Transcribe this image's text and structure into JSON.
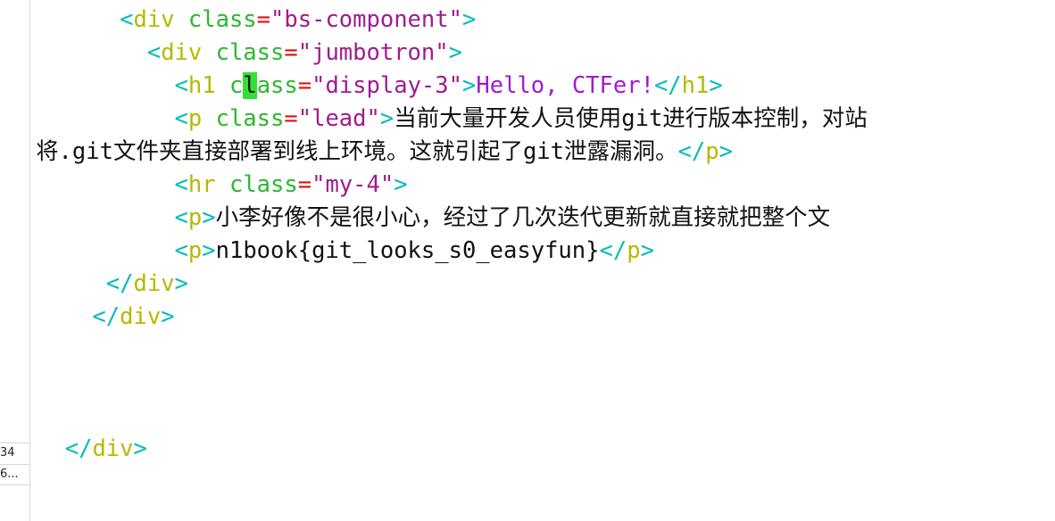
{
  "left_panel": {
    "rows": [
      "34",
      "6..."
    ]
  },
  "code_lines": [
    {
      "indent": "      ",
      "open": "<",
      "tag": "div",
      "attr": " class",
      "eq": "=",
      "value": "\"bs-component\"",
      "close": ">"
    },
    {
      "indent": "        ",
      "open": "<",
      "tag": "div",
      "attr": " class",
      "eq": "=",
      "value": "\"jumbotron\"",
      "close": ">"
    },
    {
      "indent": "          ",
      "open": "<",
      "tag": "h1",
      "attr_a": " c",
      "attr_cursor": "l",
      "attr_b": "ass",
      "eq": "=",
      "value": "\"display-3\"",
      "close": ">",
      "text": "Hello, CTFer!",
      "end_open": "</",
      "end_tag": "h1",
      "end_close": ">"
    },
    {
      "indent": "          ",
      "open": "<",
      "tag": "p",
      "attr": " class",
      "eq": "=",
      "value": "\"lead\"",
      "close": ">",
      "text_a": "当前大量开发人员使用",
      "text_b": "git",
      "text_c": "进行版本控制，对站"
    },
    {
      "text_a": "将",
      "text_b": ".git",
      "text_c": "文件夹直接部署到线上环境。这就引起了",
      "text_d": "git",
      "text_e": "泄露漏洞。",
      "end_open": "</",
      "end_tag": "p",
      "end_close": ">"
    },
    {
      "indent": "          ",
      "open": "<",
      "tag": "hr",
      "attr": " class",
      "eq": "=",
      "value": "\"my-4\"",
      "close": ">"
    },
    {
      "indent": "          ",
      "open": "<",
      "tag": "p",
      "close": ">",
      "text": "小李好像不是很小心，经过了几次迭代更新就直接就把整个文"
    },
    {
      "indent": "          ",
      "open": "<",
      "tag": "p",
      "close": ">",
      "text": "n1book{git_looks_s0_easyfun}",
      "end_open": "</",
      "end_tag": "p",
      "end_close": ">"
    },
    {
      "indent": "     ",
      "end_open": "</",
      "end_tag": "div",
      "end_close": ">"
    },
    {
      "indent": "    ",
      "end_open": "</",
      "end_tag": "div",
      "end_close": ">"
    },
    {
      "indent": "  ",
      "end_open": "</",
      "end_tag": "div",
      "end_close": ">"
    }
  ],
  "colors": {
    "bracket": "#00bcbc",
    "tag_name": "#b8b800",
    "attribute": "#2eb82e",
    "equals": "#d11111",
    "string": "#a01b8f",
    "text": "#a01bd0",
    "cursor": "#33e033"
  }
}
